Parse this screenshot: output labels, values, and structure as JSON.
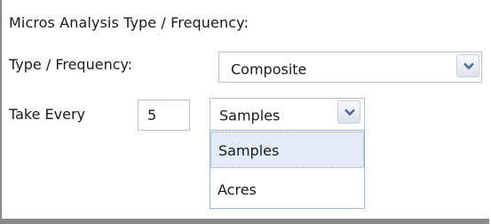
{
  "heading": "Micros Analysis Type / Frequency:",
  "type_frequency": {
    "label": "Type / Frequency:",
    "selected": "Composite"
  },
  "take_every": {
    "label": "Take Every",
    "value": "5",
    "unit_selected": "Samples",
    "options": [
      "Samples",
      "Acres"
    ],
    "highlighted_option": "Samples"
  },
  "icons": {
    "dropdown_arrow": "chevron-down-icon"
  },
  "colors": {
    "highlight": "#e4ebf6",
    "border": "#b9c3cf",
    "list_border": "#9cb8dc"
  }
}
